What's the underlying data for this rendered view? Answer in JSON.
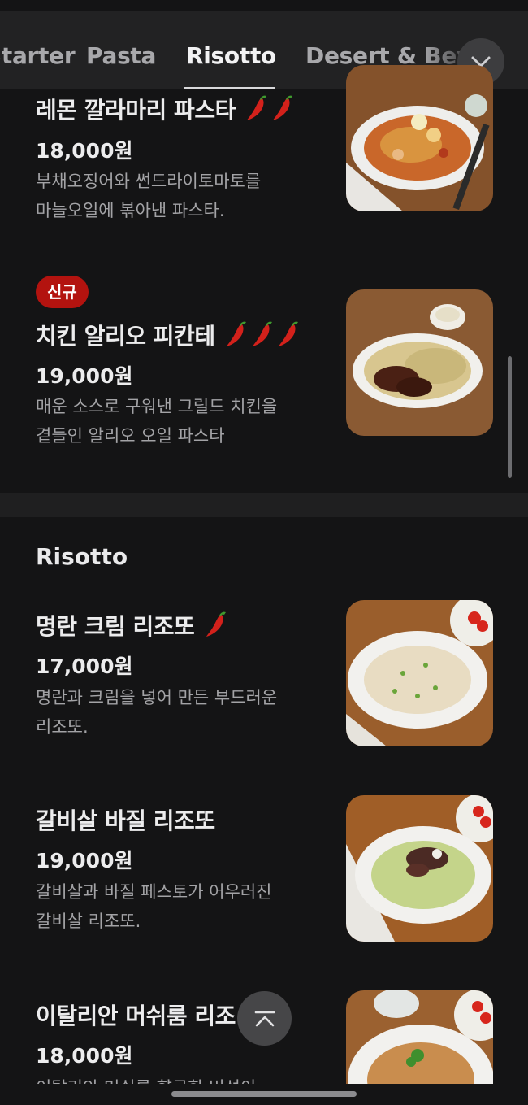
{
  "tabs": [
    {
      "label": "Starter"
    },
    {
      "label": "Pasta"
    },
    {
      "label": "Risotto"
    },
    {
      "label": "Desert & Beverage"
    }
  ],
  "active_tab": "Risotto",
  "accent_color": "#b3130f",
  "menu": {
    "item1": {
      "name": "레몬 깔라마리 파스타",
      "spice_level": 2,
      "price": "18,000원",
      "desc_line1": "부채오징어와 썬드라이토마토를",
      "desc_line2": "마늘오일에 볶아낸 파스타."
    },
    "item2": {
      "badge": "신규",
      "name": "치킨 알리오 피칸테",
      "spice_level": 3,
      "price": "19,000원",
      "desc_line1": "매운 소스로 구워낸 그릴드 치킨을",
      "desc_line2": "곁들인 알리오 오일 파스타"
    },
    "risotto_section_title": "Risotto",
    "item3": {
      "name": "명란 크림 리조또",
      "spice_level": 1,
      "price": "17,000원",
      "desc_line1": "명란과 크림을 넣어 만든 부드러운",
      "desc_line2": "리조또."
    },
    "item4": {
      "name": "갈비살 바질 리조또",
      "spice_level": 0,
      "price": "19,000원",
      "desc_line1": "갈비살과 바질 페스토가 어우러진",
      "desc_line2": "갈비살 리조또."
    },
    "item5": {
      "name": "이탈리안 머쉬룸 리조",
      "price": "18,000원",
      "desc_line1": "이탈리안 머쉬룸 향긋한 버섯이"
    }
  },
  "icons": {
    "tab_expand": "chevron-down-icon",
    "scroll_top": "arrow-up-to-top-icon",
    "spice": "chili-pepper-icon"
  }
}
